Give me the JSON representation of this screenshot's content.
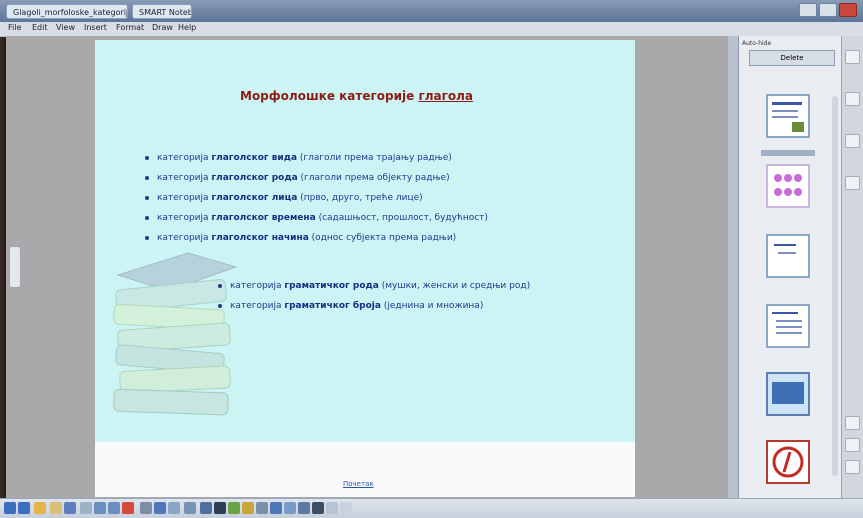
{
  "window": {
    "tab_labels": [
      "Glagoli_morfoloske_kategorije.notebook",
      "SMART Notebook"
    ],
    "menu": [
      "File",
      "Edit",
      "View",
      "Insert",
      "Format",
      "Draw",
      "Help"
    ]
  },
  "slide": {
    "title_main": "Морфолошке категорије",
    "title_accent": "глагола",
    "bullets": [
      {
        "pre": "категорија ",
        "bold": "глаголског вида",
        "post": " (глаголи према трајању радње)"
      },
      {
        "pre": "категорија ",
        "bold": "глаголског рода",
        "post": " (глаголи према објекту радње)"
      },
      {
        "pre": "категорија ",
        "bold": "глаголског лица",
        "post": " (прво, друго, треће лице)"
      },
      {
        "pre": "категорија ",
        "bold": "глаголског времена",
        "post": " (садашњост, прошлост, будућност)"
      },
      {
        "pre": "категорија ",
        "bold": "глаголског начина",
        "post": " (однос субјекта према радњи)"
      }
    ],
    "bullets2": [
      {
        "pre": "категорија ",
        "bold": "граматичког рода",
        "post": " (мушки, женски и средњи род)"
      },
      {
        "pre": "категорија ",
        "bold": "граматичког броја",
        "post": " (једнина и множина)"
      }
    ],
    "footer_link": "Почетак"
  },
  "sorter": {
    "checkbox_label": "Auto-hide",
    "button_label": "Delete"
  },
  "colors": {
    "slide_bg": "#ccf4f5",
    "title": "#8b1d14",
    "bullet_text": "#1f3a8f"
  }
}
